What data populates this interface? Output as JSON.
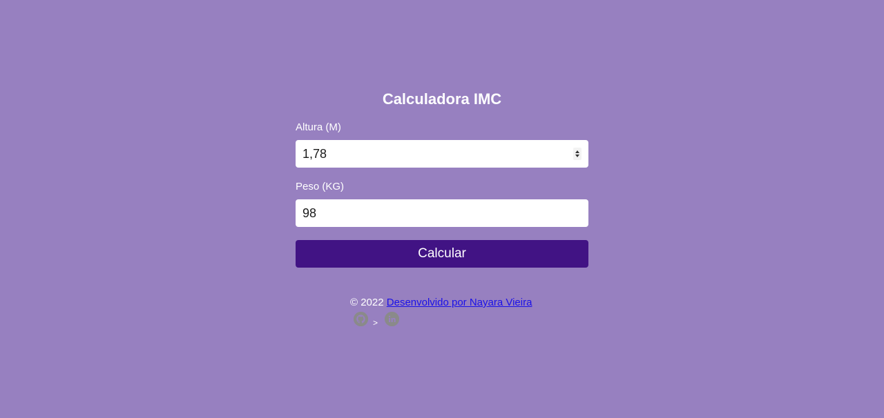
{
  "title": "Calculadora IMC",
  "altura": {
    "label": "Altura (M)",
    "value": "1,78"
  },
  "peso": {
    "label": "Peso (KG)",
    "value": "98"
  },
  "button": {
    "label": "Calcular"
  },
  "footer": {
    "copyright": "© 2022",
    "link_text": "Desenvolvido por Nayara Vieira",
    "separator": ">",
    "icons": [
      "github-icon",
      "linkedin-icon"
    ]
  },
  "colors": {
    "background": "#9780c0",
    "button": "#411384",
    "link": "#1a10e8",
    "icon": "#8a8a8a"
  }
}
